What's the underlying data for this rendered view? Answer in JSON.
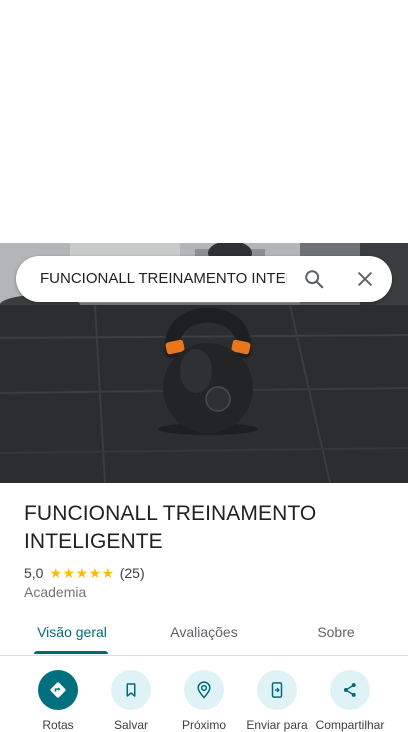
{
  "search": {
    "query": "FUNCIONALL TREINAMENTO INTELIGENTE"
  },
  "place": {
    "name": "FUNCIONALL TREINAMENTO INTELIGENTE",
    "rating": "5,0",
    "stars": "★★★★★",
    "review_count": "(25)",
    "category": "Academia"
  },
  "tabs": [
    {
      "label": "Visão geral",
      "active": true
    },
    {
      "label": "Avaliações",
      "active": false
    },
    {
      "label": "Sobre",
      "active": false
    }
  ],
  "actions": [
    {
      "label": "Rotas",
      "icon": "directions-icon"
    },
    {
      "label": "Salvar",
      "icon": "bookmark-icon"
    },
    {
      "label": "Próximo",
      "icon": "nearby-icon"
    },
    {
      "label": "Enviar para",
      "icon": "send-to-phone-icon"
    },
    {
      "label": "Compartilhar",
      "icon": "share-icon"
    }
  ],
  "colors": {
    "accent": "#006a7a",
    "action_primary": "#00707f",
    "action_bg": "#dff3f7",
    "star": "#fbbc04",
    "kettlebell_band": "#e8761d"
  }
}
